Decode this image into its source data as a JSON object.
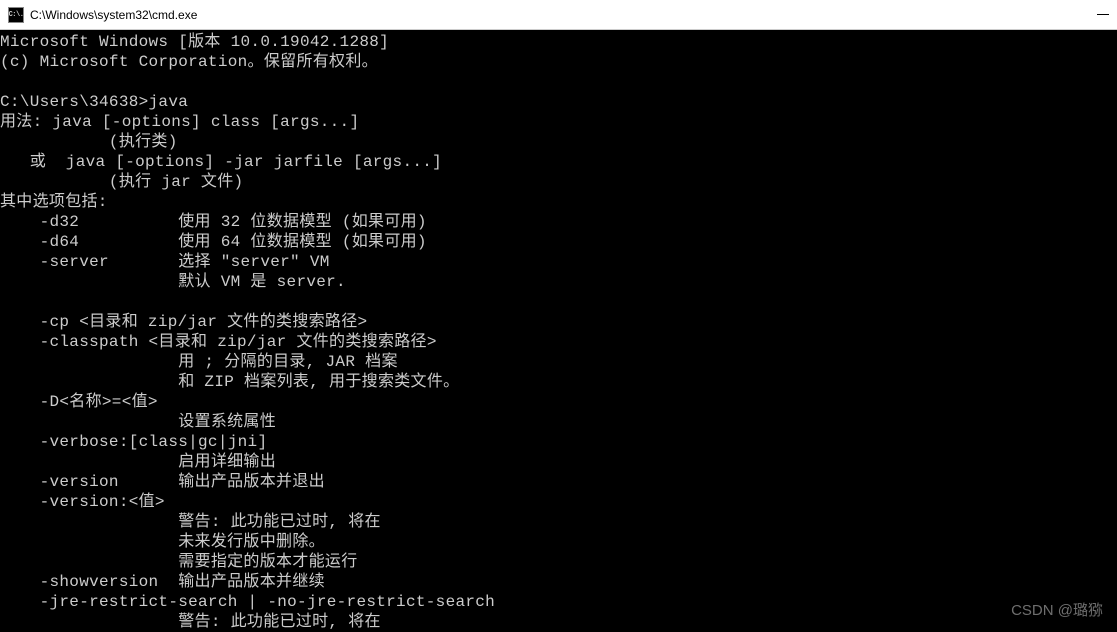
{
  "window": {
    "title": "C:\\Windows\\system32\\cmd.exe",
    "icon_label": "C:\\."
  },
  "terminal": {
    "lines": [
      "Microsoft Windows [版本 10.0.19042.1288]",
      "(c) Microsoft Corporation。保留所有权利。",
      "",
      "C:\\Users\\34638>java",
      "用法: java [-options] class [args...]",
      "           (执行类)",
      "   或  java [-options] -jar jarfile [args...]",
      "           (执行 jar 文件)",
      "其中选项包括:",
      "    -d32          使用 32 位数据模型 (如果可用)",
      "    -d64          使用 64 位数据模型 (如果可用)",
      "    -server       选择 \"server\" VM",
      "                  默认 VM 是 server.",
      "",
      "    -cp <目录和 zip/jar 文件的类搜索路径>",
      "    -classpath <目录和 zip/jar 文件的类搜索路径>",
      "                  用 ; 分隔的目录, JAR 档案",
      "                  和 ZIP 档案列表, 用于搜索类文件。",
      "    -D<名称>=<值>",
      "                  设置系统属性",
      "    -verbose:[class|gc|jni]",
      "                  启用详细输出",
      "    -version      输出产品版本并退出",
      "    -version:<值>",
      "                  警告: 此功能已过时, 将在",
      "                  未来发行版中删除。",
      "                  需要指定的版本才能运行",
      "    -showversion  输出产品版本并继续",
      "    -jre-restrict-search | -no-jre-restrict-search",
      "                  警告: 此功能已过时, 将在"
    ]
  },
  "watermark": "CSDN @璐猕"
}
